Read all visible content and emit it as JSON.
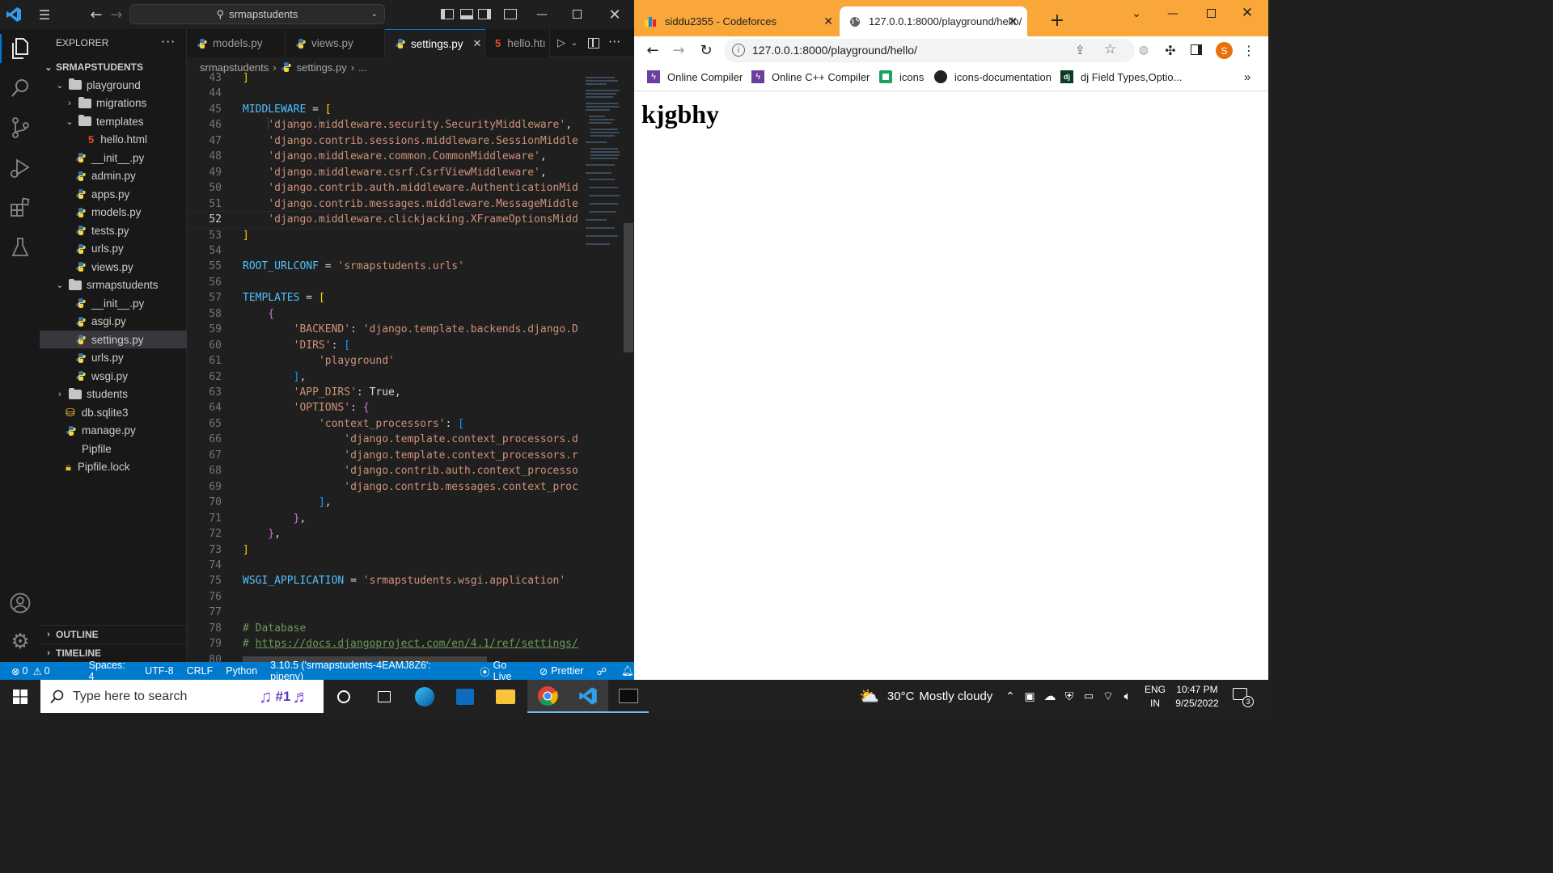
{
  "vscode": {
    "search_text": "srmapstudents",
    "explorer_title": "EXPLORER",
    "root_folder": "SRMAPSTUDENTS",
    "tree": [
      {
        "label": "playground",
        "kind": "folder",
        "expanded": true,
        "depth": 1
      },
      {
        "label": "migrations",
        "kind": "folder",
        "expanded": false,
        "depth": 2
      },
      {
        "label": "templates",
        "kind": "folder",
        "expanded": true,
        "depth": 2
      },
      {
        "label": "hello.html",
        "kind": "html",
        "depth": 3
      },
      {
        "label": "__init__.py",
        "kind": "py",
        "depth": 2
      },
      {
        "label": "admin.py",
        "kind": "py",
        "depth": 2
      },
      {
        "label": "apps.py",
        "kind": "py",
        "depth": 2
      },
      {
        "label": "models.py",
        "kind": "py",
        "depth": 2
      },
      {
        "label": "tests.py",
        "kind": "py",
        "depth": 2
      },
      {
        "label": "urls.py",
        "kind": "py",
        "depth": 2
      },
      {
        "label": "views.py",
        "kind": "py",
        "depth": 2
      },
      {
        "label": "srmapstudents",
        "kind": "folder",
        "expanded": true,
        "depth": 1
      },
      {
        "label": "__init__.py",
        "kind": "py",
        "depth": 2
      },
      {
        "label": "asgi.py",
        "kind": "py",
        "depth": 2
      },
      {
        "label": "settings.py",
        "kind": "py",
        "depth": 2,
        "selected": true
      },
      {
        "label": "urls.py",
        "kind": "py",
        "depth": 2
      },
      {
        "label": "wsgi.py",
        "kind": "py",
        "depth": 2
      },
      {
        "label": "students",
        "kind": "folder",
        "expanded": false,
        "depth": 1
      },
      {
        "label": "db.sqlite3",
        "kind": "db",
        "depth": 1
      },
      {
        "label": "manage.py",
        "kind": "py",
        "depth": 1
      },
      {
        "label": "Pipfile",
        "kind": "file",
        "depth": 1
      },
      {
        "label": "Pipfile.lock",
        "kind": "lock",
        "depth": 1
      }
    ],
    "outline_label": "OUTLINE",
    "timeline_label": "TIMELINE",
    "tabs": [
      {
        "label": "models.py",
        "kind": "py"
      },
      {
        "label": "views.py",
        "kind": "py"
      },
      {
        "label": "settings.py",
        "kind": "py",
        "active": true
      },
      {
        "label": "hello.htı",
        "kind": "html"
      }
    ],
    "breadcrumb": [
      "srmapstudents",
      "settings.py",
      "..."
    ],
    "code_lines": [
      {
        "n": "43",
        "t": "]"
      },
      {
        "n": "44",
        "t": ""
      },
      {
        "n": "45",
        "t": "MIDDLEWARE = ["
      },
      {
        "n": "46",
        "t": "    'django.middleware.security.SecurityMiddleware',"
      },
      {
        "n": "47",
        "t": "    'django.contrib.sessions.middleware.SessionMiddle"
      },
      {
        "n": "48",
        "t": "    'django.middleware.common.CommonMiddleware',"
      },
      {
        "n": "49",
        "t": "    'django.middleware.csrf.CsrfViewMiddleware',"
      },
      {
        "n": "50",
        "t": "    'django.contrib.auth.middleware.AuthenticationMid"
      },
      {
        "n": "51",
        "t": "    'django.contrib.messages.middleware.MessageMiddle"
      },
      {
        "n": "52",
        "t": "    'django.middleware.clickjacking.XFrameOptionsMidd"
      },
      {
        "n": "53",
        "t": "]"
      },
      {
        "n": "54",
        "t": ""
      },
      {
        "n": "55",
        "t": "ROOT_URLCONF = 'srmapstudents.urls'"
      },
      {
        "n": "56",
        "t": ""
      },
      {
        "n": "57",
        "t": "TEMPLATES = ["
      },
      {
        "n": "58",
        "t": "    {"
      },
      {
        "n": "59",
        "t": "        'BACKEND': 'django.template.backends.django.D"
      },
      {
        "n": "60",
        "t": "        'DIRS': ["
      },
      {
        "n": "61",
        "t": "            'playground'"
      },
      {
        "n": "62",
        "t": "        ],"
      },
      {
        "n": "63",
        "t": "        'APP_DIRS': True,"
      },
      {
        "n": "64",
        "t": "        'OPTIONS': {"
      },
      {
        "n": "65",
        "t": "            'context_processors': ["
      },
      {
        "n": "66",
        "t": "                'django.template.context_processors.d"
      },
      {
        "n": "67",
        "t": "                'django.template.context_processors.r"
      },
      {
        "n": "68",
        "t": "                'django.contrib.auth.context_processo"
      },
      {
        "n": "69",
        "t": "                'django.contrib.messages.context_proc"
      },
      {
        "n": "70",
        "t": "            ],"
      },
      {
        "n": "71",
        "t": "        },"
      },
      {
        "n": "72",
        "t": "    },"
      },
      {
        "n": "73",
        "t": "]"
      },
      {
        "n": "74",
        "t": ""
      },
      {
        "n": "75",
        "t": "WSGI_APPLICATION = 'srmapstudents.wsgi.application'"
      },
      {
        "n": "76",
        "t": ""
      },
      {
        "n": "77",
        "t": ""
      },
      {
        "n": "78",
        "t": "# Database"
      },
      {
        "n": "79",
        "t": "# https://docs.djangoproject.com/en/4.1/ref/settings/"
      },
      {
        "n": "80",
        "t": ""
      }
    ],
    "current_line": "52",
    "status": {
      "errors": "0",
      "warnings": "0",
      "spaces": "Spaces: 4",
      "encoding": "UTF-8",
      "eol": "CRLF",
      "language": "Python",
      "interpreter": "3.10.5 ('srmapstudents-4EAMJ8Z6': pipenv)",
      "golive": "Go Live",
      "prettier": "Prettier"
    }
  },
  "browser": {
    "tabs": [
      {
        "title": "siddu2355 - Codeforces"
      },
      {
        "title": "127.0.0.1:8000/playground/hello/",
        "active": true
      }
    ],
    "url": "127.0.0.1:8000/playground/hello/",
    "profile_initial": "S",
    "bookmarks": [
      "Online Compiler",
      "Online C++ Compiler",
      "icons",
      "icons-documentation",
      "dj Field Types,Optio..."
    ],
    "bookmark_more": "»",
    "page_heading": "kjgbhy"
  },
  "taskbar": {
    "search_placeholder": "Type here to search",
    "weather_temp": "30°C",
    "weather_desc": "Mostly cloudy",
    "lang_top": "ENG",
    "lang_bottom": "IN",
    "time": "10:47 PM",
    "date": "9/25/2022",
    "notif_count": "3",
    "search_badge": "#1"
  }
}
